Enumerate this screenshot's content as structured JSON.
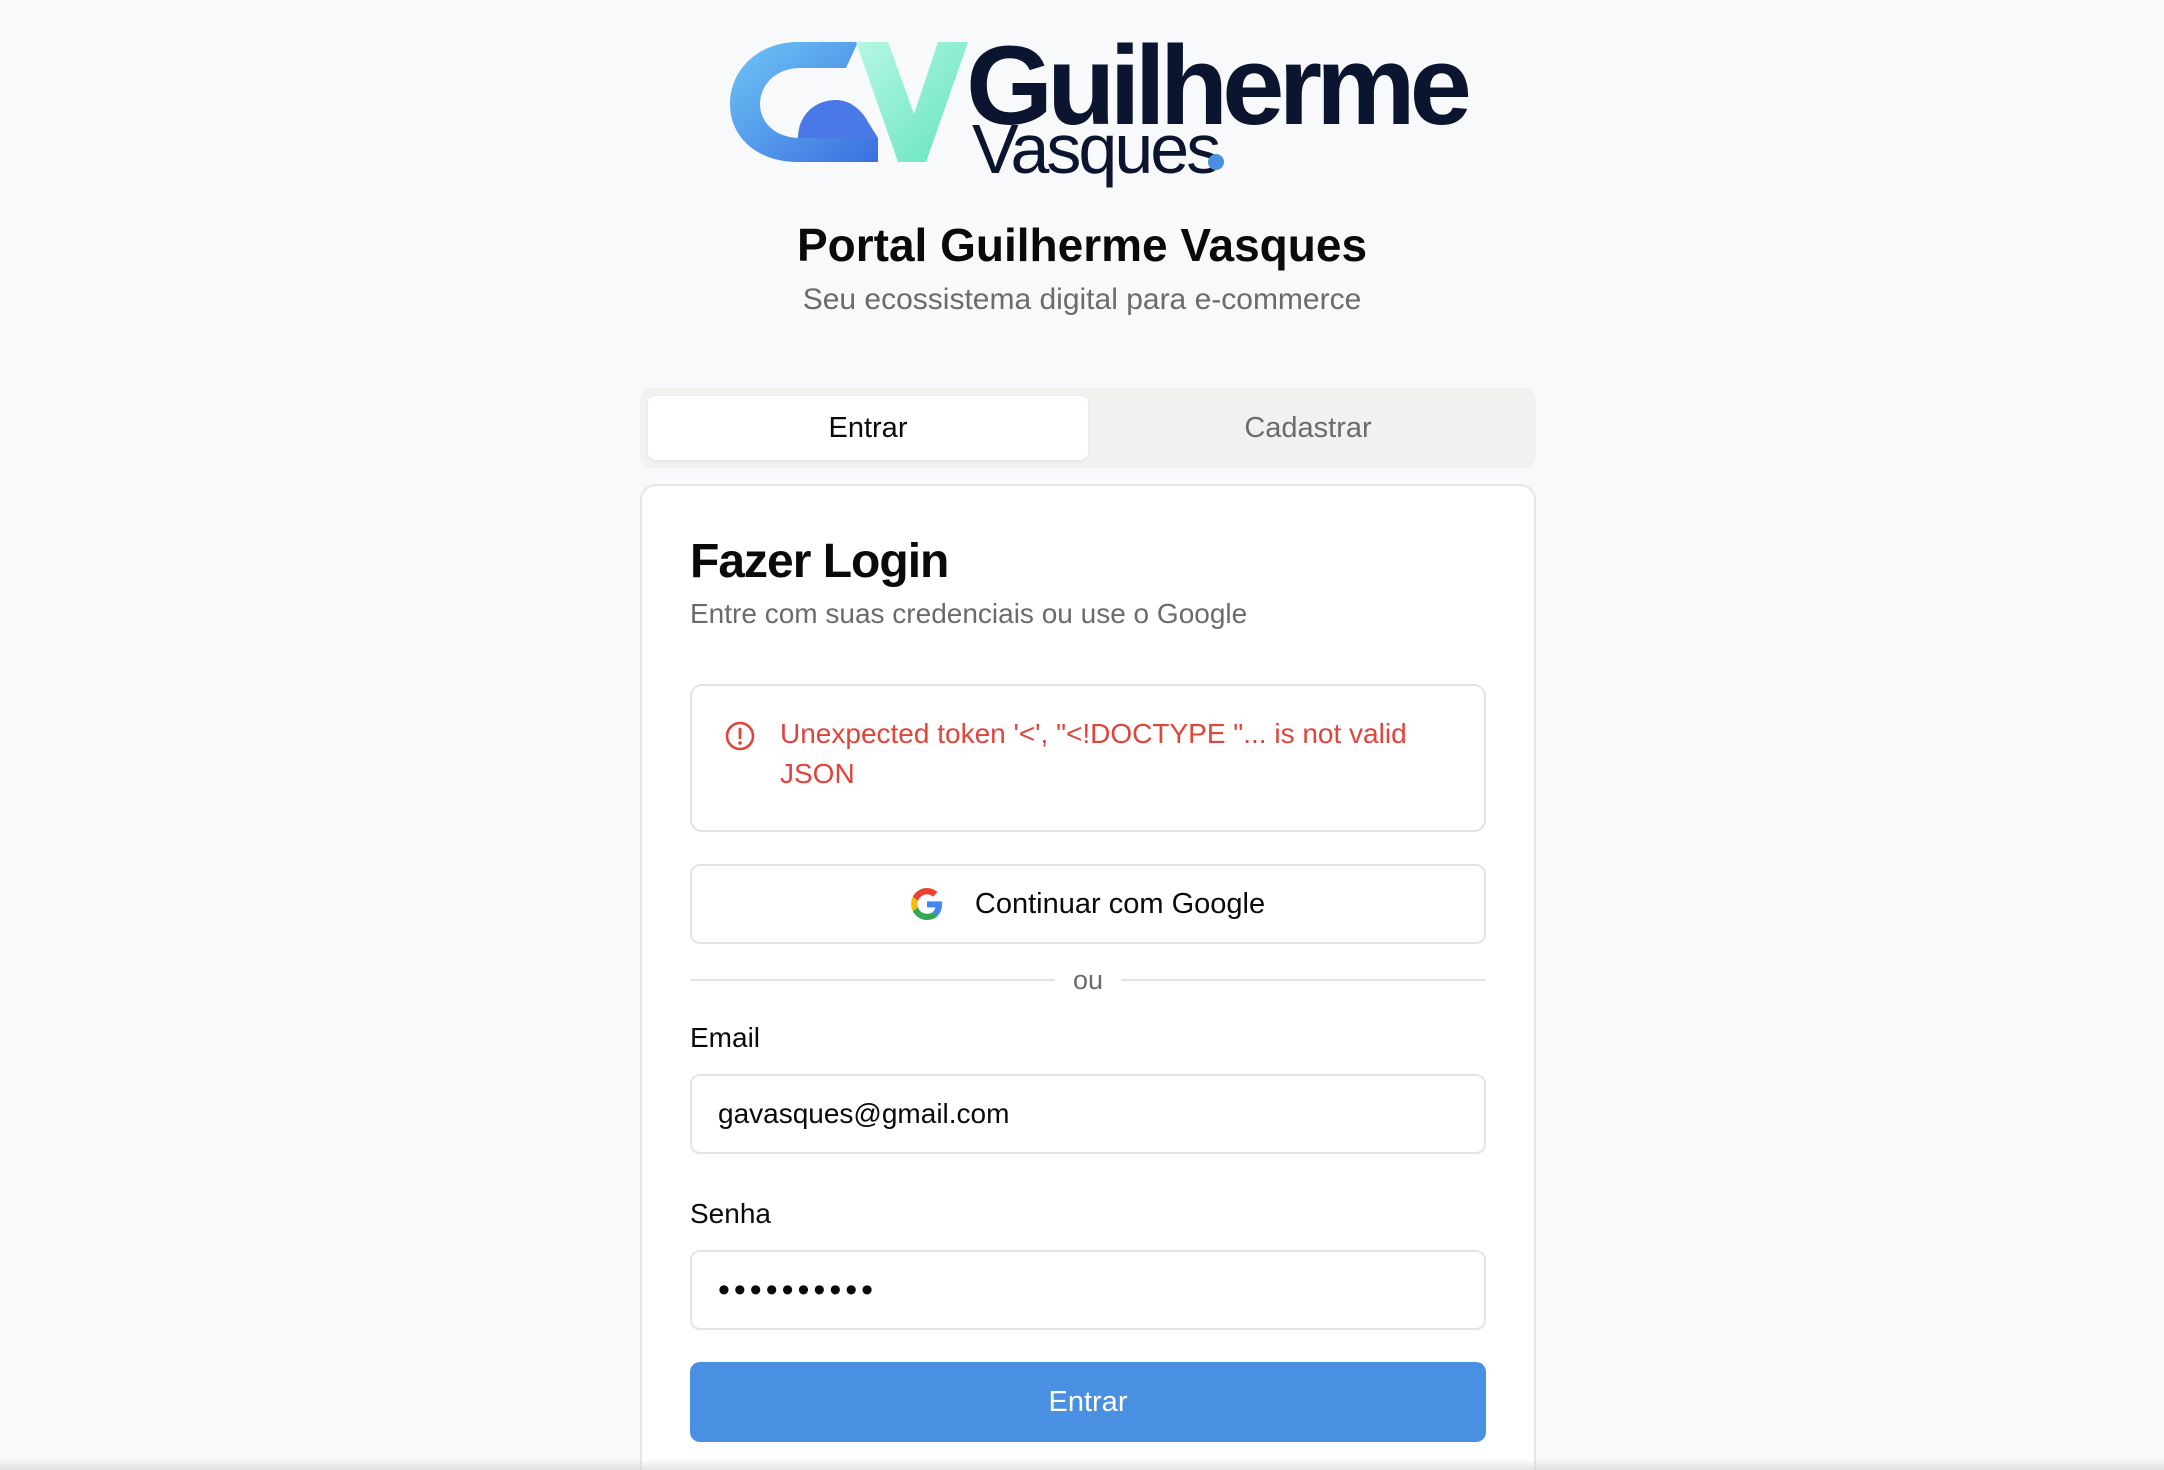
{
  "logo": {
    "word1": "Guilherme",
    "word2": "Vasques",
    "colors": {
      "navy": "#0b1530",
      "blue": "#4a90e2",
      "mint": "#8ff0d0"
    }
  },
  "header": {
    "title": "Portal Guilherme Vasques",
    "subtitle": "Seu ecossistema digital para e-commerce"
  },
  "tabs": [
    {
      "label": "Entrar",
      "active": true
    },
    {
      "label": "Cadastrar",
      "active": false
    }
  ],
  "login": {
    "title": "Fazer Login",
    "description": "Entre com suas credenciais ou use o Google",
    "error": {
      "icon": "alert-circle-icon",
      "message": "Unexpected token '<', \"<!DOCTYPE \"... is not valid JSON"
    },
    "google_button": {
      "icon": "google-icon",
      "label": "Continuar com Google"
    },
    "divider_text": "ou",
    "email": {
      "label": "Email",
      "value": "gavasques@gmail.com"
    },
    "password": {
      "label": "Senha",
      "masked_value": "••••••••••"
    },
    "submit_label": "Entrar"
  },
  "theme": {
    "accent": "#4a90e2",
    "error": "#e0443b",
    "muted_text": "#6b6b6b",
    "border": "#e3e3e3",
    "background": "#f8f9fa"
  }
}
